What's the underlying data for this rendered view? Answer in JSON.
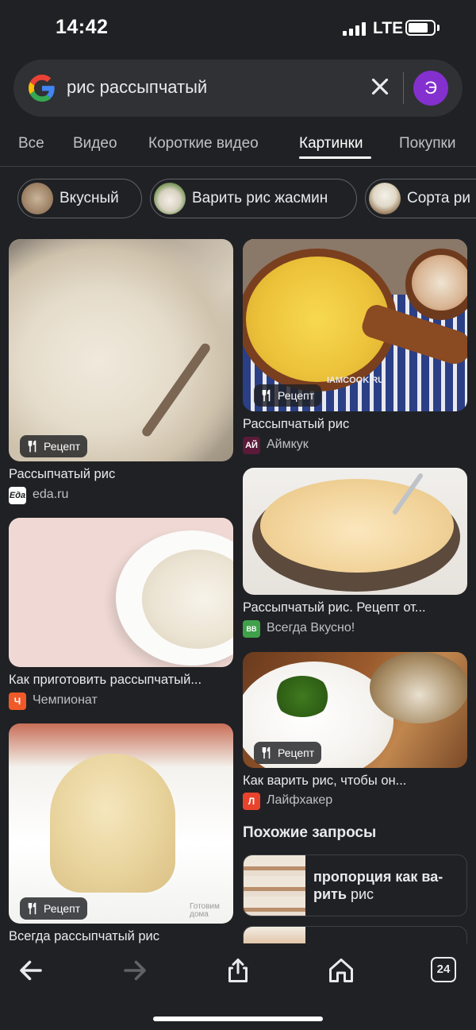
{
  "status": {
    "time": "14:42",
    "network": "LTE"
  },
  "search": {
    "query": "рис рассыпчатый",
    "avatar_letter": "Э"
  },
  "tabs": [
    {
      "label": "Все"
    },
    {
      "label": "Видео"
    },
    {
      "label": "Короткие видео"
    },
    {
      "label": "Картинки",
      "active": true
    },
    {
      "label": "Покупки"
    }
  ],
  "chips": [
    {
      "label": "Вкусный"
    },
    {
      "label": "Варить рис жасмин"
    },
    {
      "label": "Сорта ри"
    }
  ],
  "results": [
    {
      "title": "Рассыпчатый рис",
      "source": "eda.ru",
      "favicon": "Eда",
      "badge": "Рецепт"
    },
    {
      "title": "Рассыпчатый рис",
      "source": "Аймкук",
      "favicon": "АЙ",
      "badge": "Рецепт",
      "watermark": "IAMCOOK.RU"
    },
    {
      "title": "Как приготовить рассыпчатый...",
      "source": "Чемпионат",
      "favicon": "Ч"
    },
    {
      "title": "Рассыпчатый рис. Рецепт от...",
      "source": "Всегда Вкусно!",
      "favicon": "ВВ"
    },
    {
      "title": "Как варить рис, чтобы он...",
      "source": "Лайфхакер",
      "favicon": "Л",
      "badge": "Рецепт"
    },
    {
      "title": "Всегда рассыпчатый рис",
      "badge": "Рецепт",
      "watermark": "Готовим дома"
    }
  ],
  "related": {
    "heading": "Похожие запросы",
    "items": [
      {
        "bold": "пропорция как ва-рить",
        "normal": "рис"
      },
      {
        "bold": "",
        "normal": ""
      }
    ]
  },
  "bottom_nav": {
    "tab_count": "24"
  },
  "colors": {
    "background": "#202124",
    "avatar": "#8430ce",
    "badge": "#202124"
  }
}
